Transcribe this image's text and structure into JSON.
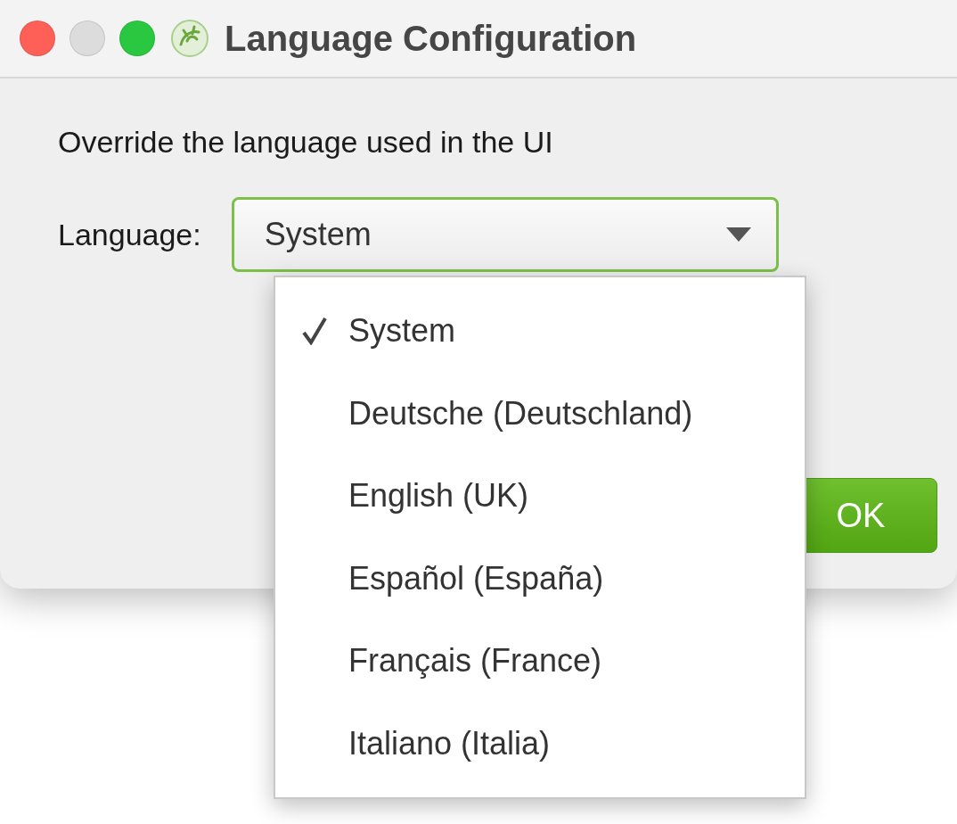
{
  "window": {
    "title": "Language Configuration"
  },
  "description": "Override the language used in the UI",
  "language_field": {
    "label": "Language:",
    "value": "System",
    "expanded": true
  },
  "dropdown_options": [
    {
      "label": "System",
      "selected": true
    },
    {
      "label": "Deutsche (Deutschland)",
      "selected": false
    },
    {
      "label": "English (UK)",
      "selected": false
    },
    {
      "label": "Español (España)",
      "selected": false
    },
    {
      "label": "Français (France)",
      "selected": false
    },
    {
      "label": "Italiano (Italia)",
      "selected": false
    }
  ],
  "buttons": [
    {
      "label": "OK",
      "kind": "primary"
    }
  ]
}
